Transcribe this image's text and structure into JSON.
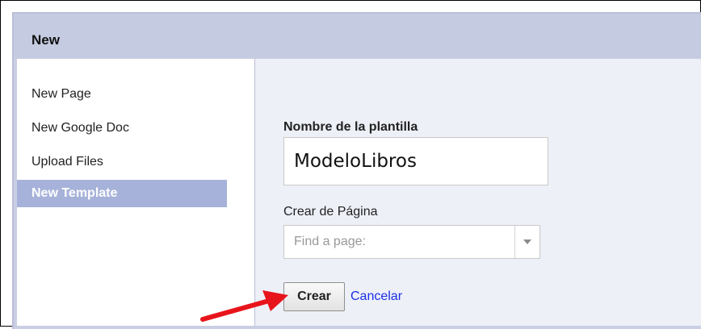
{
  "dialog": {
    "title": "New"
  },
  "sidebar": {
    "items": [
      {
        "label": "New Page",
        "selected": false
      },
      {
        "label": "New Google Doc",
        "selected": false
      },
      {
        "label": "Upload Files",
        "selected": false
      },
      {
        "label": "New Template",
        "selected": true
      }
    ]
  },
  "form": {
    "name_label": "Nombre de la plantilla",
    "name_value": "ModeloLibros",
    "source_label": "Crear de Página",
    "source_placeholder": "Find a page:",
    "create_label": "Crear",
    "cancel_label": "Cancelar"
  },
  "colors": {
    "header_bg": "#c5cbe1",
    "selected_item_bg": "#a6b2d9",
    "link": "#1a2ee6",
    "annotation_arrow": "#e8141b"
  }
}
